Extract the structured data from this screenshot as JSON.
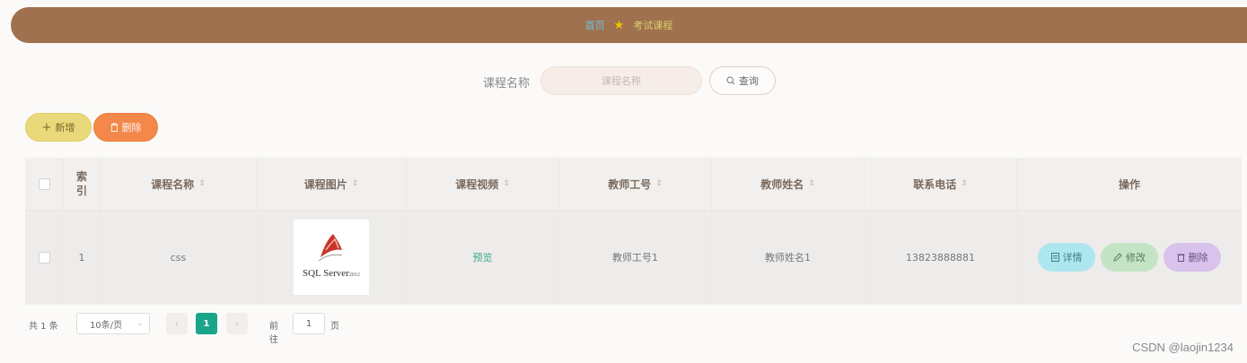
{
  "breadcrumb": {
    "home": "首页",
    "separator_icon": "star-icon",
    "current": "考试课程"
  },
  "search": {
    "label": "课程名称",
    "placeholder": "课程名称",
    "value": "",
    "query_label": "查询"
  },
  "actions": {
    "add_label": "新增",
    "delete_label": "删除"
  },
  "table": {
    "headers": {
      "index": [
        "索",
        "引"
      ],
      "course_name": "课程名称",
      "course_image": "课程图片",
      "course_video": "课程视频",
      "teacher_id": "教师工号",
      "teacher_name": "教师姓名",
      "phone": "联系电话",
      "operations": "操作"
    },
    "rows": [
      {
        "index": "1",
        "course_name": "css",
        "image": {
          "logo_text": "SQL Server",
          "logo_year": "2012"
        },
        "video_link": "预览",
        "teacher_id": "教师工号1",
        "teacher_name": "教师姓名1",
        "phone": "13823888881",
        "ops": {
          "detail": "详情",
          "edit": "修改",
          "delete": "删除"
        }
      }
    ]
  },
  "pagination": {
    "total_text": "共 1 条",
    "page_size": "10条/页",
    "current_page": "1",
    "goto_prefix": "前往",
    "goto_value": "1",
    "goto_suffix": "页"
  },
  "watermark": "CSDN @laojin1234",
  "colors": {
    "header_bar": "#a0714f",
    "active_page": "#1aa58a",
    "add": "#e9d97a",
    "delete": "#f3884a"
  }
}
